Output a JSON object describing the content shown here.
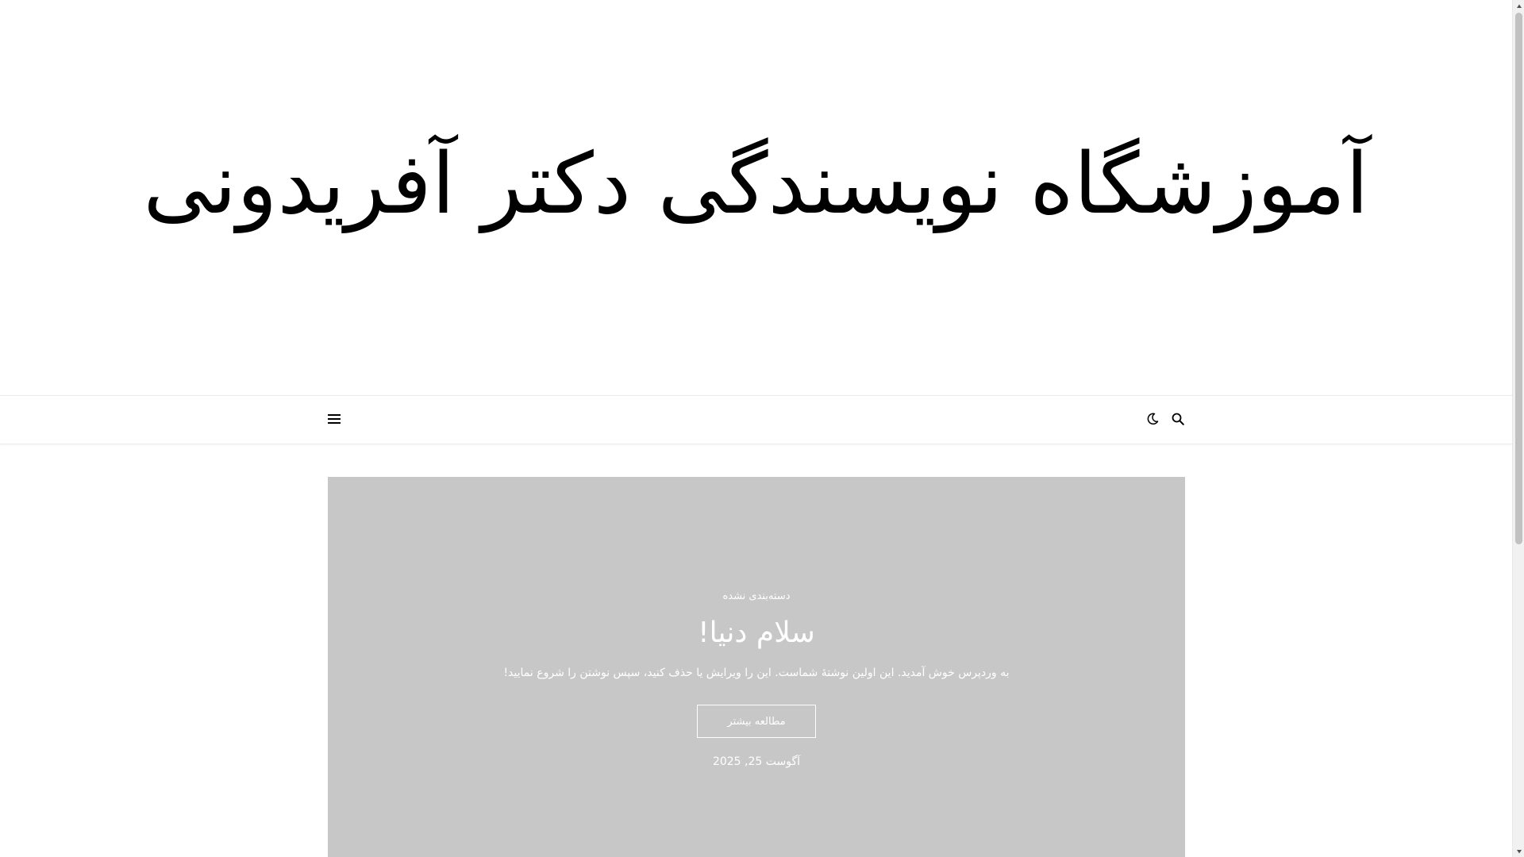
{
  "site": {
    "title": "آموزشگاه نویسندگی دکتر آفریدونی"
  },
  "nav": {
    "menu_icon": "hamburger-icon",
    "dark_mode_icon": "moon-icon",
    "search_icon": "search-icon"
  },
  "featured_post": {
    "category": "دسته‌بندی نشده",
    "title": "سلام دنیا!",
    "excerpt": "به وردپرس خوش آمدید. این اولین نوشتهٔ شماست. این را ویرایش یا حذف کنید، سپس نوشتن را شروع نمایید!",
    "read_more_label": "مطالعه بیشتر",
    "date": "آگوست 25, 2025"
  },
  "colors": {
    "background": "#ffffff",
    "featured_bg": "#c7c7c7",
    "text": "#000000",
    "text_on_featured": "#ffffff"
  }
}
